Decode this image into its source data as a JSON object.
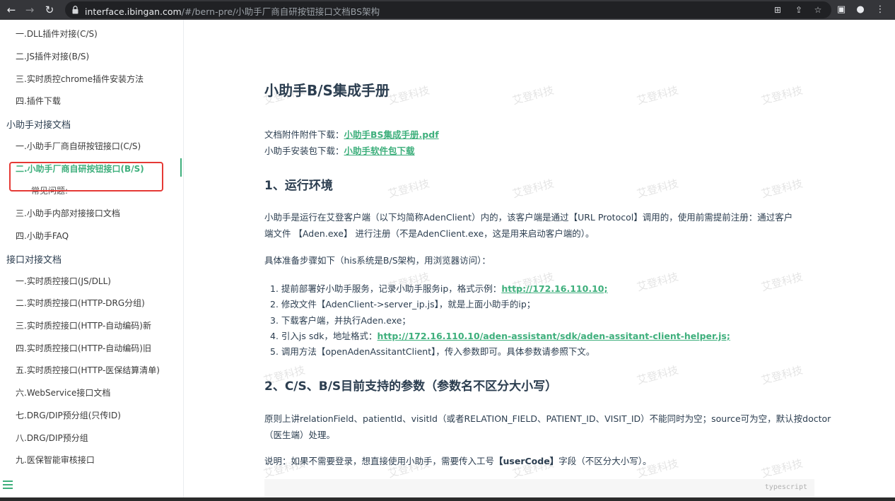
{
  "browser": {
    "url_host": "interface.ibingan.com",
    "url_path": "/#/bern-pre/小助手厂商自研按钮接口文档BS架构",
    "back_glyph": "←",
    "forward_glyph": "→",
    "reload_glyph": "↻",
    "translate_glyph": "⊞",
    "share_glyph": "⇪",
    "star_glyph": "☆",
    "panel_glyph": "▣",
    "profile_glyph": "●",
    "menu_glyph": "⋮"
  },
  "sidebar": {
    "items": [
      {
        "label": "一.DLL插件对接(C/S)",
        "kind": "item"
      },
      {
        "label": "二.JS插件对接(B/S)",
        "kind": "item"
      },
      {
        "label": "三.实时质控chrome插件安装方法",
        "kind": "item"
      },
      {
        "label": "四.插件下载",
        "kind": "item"
      },
      {
        "label": "小助手对接文档",
        "kind": "section"
      },
      {
        "label": "一.小助手厂商自研按钮接口(C/S)",
        "kind": "item"
      },
      {
        "label": "二.小助手厂商自研按钮接口(B/S)",
        "kind": "active"
      },
      {
        "label": "常见问题:",
        "kind": "sub"
      },
      {
        "label": "三.小助手内部对接接口文档",
        "kind": "item"
      },
      {
        "label": "四.小助手FAQ",
        "kind": "item"
      },
      {
        "label": "接口对接文档",
        "kind": "section"
      },
      {
        "label": "一.实时质控接口(JS/DLL)",
        "kind": "item"
      },
      {
        "label": "二.实时质控接口(HTTP-DRG分组)",
        "kind": "item"
      },
      {
        "label": "三.实时质控接口(HTTP-自动编码)新",
        "kind": "item"
      },
      {
        "label": "四.实时质控接口(HTTP-自动编码)旧",
        "kind": "item"
      },
      {
        "label": "五.实时质控接口(HTTP-医保结算清单)",
        "kind": "item"
      },
      {
        "label": "六.WebService接口文档",
        "kind": "item"
      },
      {
        "label": "七.DRG/DIP预分组(只传ID)",
        "kind": "item"
      },
      {
        "label": "八.DRG/DIP预分组",
        "kind": "item"
      },
      {
        "label": "九.医保智能审核接口",
        "kind": "item"
      }
    ]
  },
  "content": {
    "watermark": "艾登科技",
    "title": "小助手B/S集成手册",
    "downloads": [
      {
        "prefix": "文档附件附件下载：",
        "link": "小助手BS集成手册.pdf"
      },
      {
        "prefix": "小助手安装包下载：",
        "link": "小助手软件包下载"
      }
    ],
    "section1_title": "1、运行环境",
    "section1_para_line1": "小助手是运行在艾登客户端（以下均简称AdenClient）内的，该客户端是通过【URL Protocol】调用的，使用前需提前注册：通过客户",
    "section1_para_line2": "端文件 【Aden.exe】 进行注册（不是AdenClient.exe，这是用来启动客户端的）。",
    "steps_intro": "具体准备步骤如下（his系统是B/S架构，用浏览器访问）：",
    "steps": [
      {
        "text": "1. 提前部署好小助手服务，记录小助手服务ip，格式示例：",
        "link": "http://172.16.110.10;"
      },
      {
        "text": "2. 修改文件【AdenClient->server_ip.js】，就是上面小助手的ip；",
        "link": ""
      },
      {
        "text": "3. 下载客户端，并执行Aden.exe；",
        "link": ""
      },
      {
        "text": "4. 引入js sdk，地址格式：",
        "link": "http://172.16.110.10/aden-assistant/sdk/aden-assitant-client-helper.js;"
      },
      {
        "text": "5. 调用方法【openAdenAssitantClient】，传入参数即可。具体参数请参照下文。",
        "link": ""
      }
    ],
    "section2_title": "2、C/S、B/S目前支持的参数（参数名不区分大小写）",
    "section2_para_line1": "原则上讲relationField、patientId、visitId（或者RELATION_FIELD、PATIENT_ID、VISIT_ID）不能同时为空；source可为空，默认按doctor",
    "section2_para_line2": "（医生端）处理。",
    "note_prefix": "说明：如果不需要登录，想直接使用小助手，需要传入工号",
    "note_code": "【userCode】",
    "note_suffix": "字段（不区分大小写）。",
    "code_lang": "typescript"
  },
  "colors": {
    "accent": "#3eaf7c",
    "highlight_border": "#e53935",
    "chrome_bg": "#35363a"
  }
}
